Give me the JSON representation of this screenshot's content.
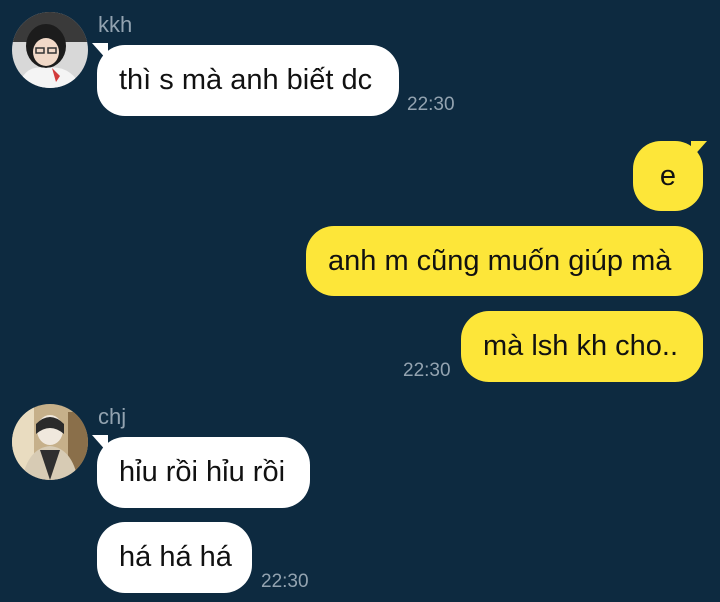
{
  "colors": {
    "background": "#0d2a40",
    "incoming_bubble": "#ffffff",
    "outgoing_bubble": "#fde639",
    "meta_text": "#93a3b0"
  },
  "messages": [
    {
      "sender": "kkh",
      "avatar": "kkh-avatar",
      "lines": [
        "thì s mà anh biết dc"
      ],
      "time": "22:30"
    },
    {
      "sender": "me",
      "lines": [
        "e",
        "anh m cũng muốn giúp mà",
        "mà lsh kh cho.."
      ],
      "time": "22:30"
    },
    {
      "sender": "chj",
      "avatar": "chj-avatar",
      "lines": [
        "hỉu rồi hỉu rồi",
        "há há há"
      ],
      "time": "22:30"
    }
  ]
}
